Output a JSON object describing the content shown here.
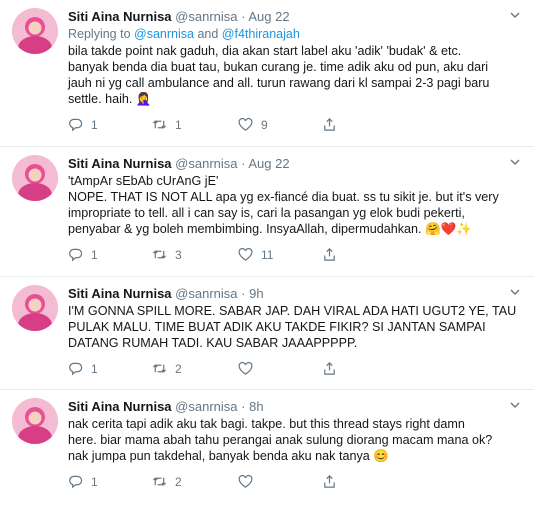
{
  "author": {
    "name": "Siti Aina Nurnisa",
    "handle": "@sanrnisa"
  },
  "colors": {
    "link": "#1b95e0",
    "muted": "#657786",
    "text": "#14171a",
    "divider": "#e6ecf0"
  },
  "tweets": [
    {
      "time": "Aug 22",
      "reply_prefix": "Replying to",
      "reply_user1": "@sanrnisa",
      "reply_and": "and",
      "reply_user2": "@f4thiranajah",
      "lines": [
        "bila takde point nak gaduh, dia akan start label aku 'adik' 'budak' & etc.",
        "banyak benda dia buat tau, bukan curang je. time adik aku od pun, aku dari",
        "jauh ni yg call ambulance and all. turun rawang dari kl sampai 2-3 pagi baru",
        "settle. haih. 🤦‍♀️"
      ],
      "replies": "1",
      "retweets": "1",
      "likes": "9"
    },
    {
      "time": "Aug 22",
      "lines": [
        "'tAmpAr sEbAb cUrAnG jE'",
        "NOPE. THAT IS NOT ALL apa yg ex-fiancé dia buat. ss tu sikit je. but it's very",
        "impropriate to tell. all i can say is, cari la pasangan yg elok budi pekerti,",
        "penyabar & yg boleh membimbing. InsyaAllah, dipermudahkan. 🤗❤️✨"
      ],
      "replies": "1",
      "retweets": "3",
      "likes": "11"
    },
    {
      "time": "9h",
      "lines": [
        "I'M GONNA SPILL MORE. SABAR JAP. DAH VIRAL ADA HATI UGUT2 YE, TAU",
        "PULAK MALU. TIME BUAT ADIK AKU TAKDE FIKIR? SI JANTAN SAMPAI",
        "DATANG RUMAH TADI. KAU SABAR JAAAPPPPP."
      ],
      "replies": "1",
      "retweets": "2",
      "likes": ""
    },
    {
      "time": "8h",
      "lines": [
        "nak cerita tapi adik aku tak bagi. takpe. but this thread stays right damn",
        "here. biar mama abah tahu perangai anak sulung diorang macam mana ok?",
        "nak jumpa pun takdehal, banyak benda aku nak tanya 😊"
      ],
      "replies": "1",
      "retweets": "2",
      "likes": ""
    }
  ],
  "icons": {
    "reply": "reply-icon",
    "retweet": "retweet-icon",
    "like": "heart-icon",
    "share": "share-icon",
    "more": "chevron-down-icon"
  }
}
